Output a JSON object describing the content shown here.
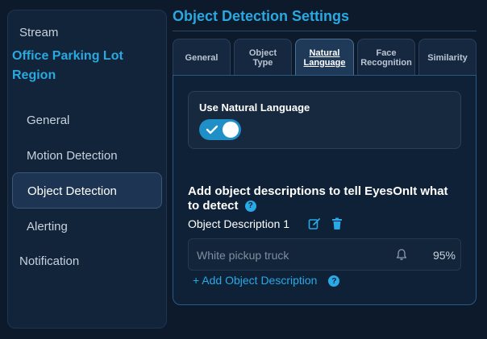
{
  "sidebar": {
    "stream": "Stream",
    "region": "Office Parking Lot Region",
    "items": [
      {
        "label": "General"
      },
      {
        "label": "Motion Detection"
      },
      {
        "label": "Object Detection"
      },
      {
        "label": "Alerting"
      }
    ],
    "notification": "Notification"
  },
  "main": {
    "title": "Object Detection Settings",
    "tabs": [
      {
        "label": "General"
      },
      {
        "label": "Object Type"
      },
      {
        "label": "Natural Language",
        "active": true
      },
      {
        "label": "Face Recognition"
      },
      {
        "label": "Similarity"
      }
    ],
    "toggle": {
      "label": "Use Natural Language",
      "state": "on"
    },
    "description_heading": "Add object descriptions to tell EyesOnIt what to detect",
    "help_glyph": "?",
    "object_description": {
      "label": "Object Description 1",
      "value": "White pickup truck",
      "threshold": "95%"
    },
    "add_link": "+ Add Object Description"
  },
  "colors": {
    "accent": "#2aa8e0",
    "background": "#0c1a2c",
    "toggle_on": "#1f8fc8"
  },
  "icons": [
    "edit-icon",
    "trash-icon",
    "bell-icon",
    "help-icon",
    "check-icon"
  ]
}
